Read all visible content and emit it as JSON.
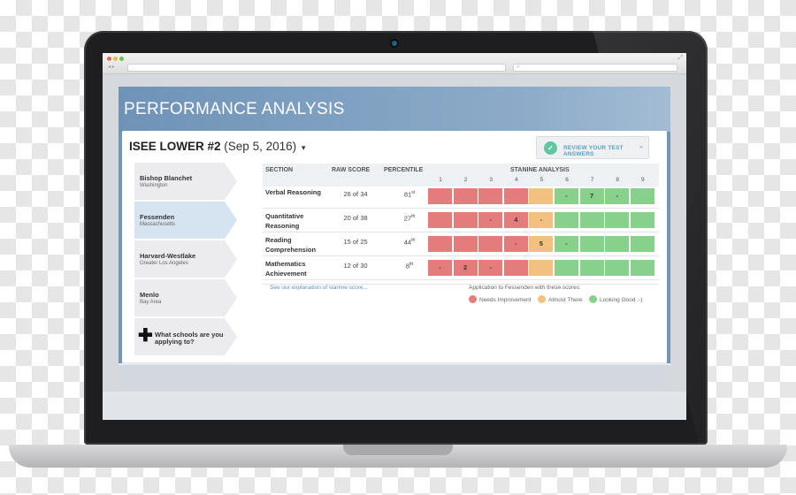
{
  "browser": {
    "url": "",
    "search": "",
    "nav": "◂ ▸"
  },
  "header": {
    "title": "PERFORMANCE ANALYSIS"
  },
  "test": {
    "name": "ISEE LOWER #2",
    "date": "(Sep 5, 2016)",
    "review_button": "REVIEW YOUR TEST ANSWERS"
  },
  "schools": [
    {
      "name": "Bishop Blanchet",
      "location": "Washington"
    },
    {
      "name": "Fessenden",
      "location": "Massachusetts"
    },
    {
      "name": "Harvard-Westlake",
      "location": "Greater Los Angeles"
    },
    {
      "name": "Menlo",
      "location": "Bay Area"
    }
  ],
  "add_school": "What schools are you applying to?",
  "table": {
    "headers": {
      "section": "SECTION",
      "raw": "RAW SCORE",
      "percentile": "PERCENTILE",
      "stanine": "STANINE ANALYSIS"
    },
    "stanine_columns": [
      "1",
      "2",
      "3",
      "4",
      "5",
      "6",
      "7",
      "8",
      "9"
    ],
    "rows": [
      {
        "section": "Verbal Reasoning",
        "raw": "26 of 34",
        "pct": "81",
        "pct_suffix": "st",
        "cells": [
          "red",
          "red",
          "red",
          "red",
          "orange",
          "green",
          "green",
          "green",
          "green"
        ],
        "marks": [
          "",
          "",
          "",
          "",
          "",
          "-",
          "7",
          "-",
          ""
        ]
      },
      {
        "section": "Quantitative Reasoning",
        "raw": "20 of 38",
        "pct": "27",
        "pct_suffix": "th",
        "cells": [
          "red",
          "red",
          "red",
          "red",
          "orange",
          "green",
          "green",
          "green",
          "green"
        ],
        "marks": [
          "",
          "",
          "-",
          "4",
          "-",
          "",
          "",
          "",
          ""
        ]
      },
      {
        "section": "Reading Comprehension",
        "raw": "15 of 25",
        "pct": "44",
        "pct_suffix": "th",
        "cells": [
          "red",
          "red",
          "red",
          "red",
          "orange",
          "green",
          "green",
          "green",
          "green"
        ],
        "marks": [
          "",
          "",
          "",
          "-",
          "5",
          "-",
          "",
          "",
          ""
        ]
      },
      {
        "section": "Mathematics Achievement",
        "raw": "12 of 30",
        "pct": "8",
        "pct_suffix": "th",
        "cells": [
          "red",
          "red",
          "red",
          "red",
          "orange",
          "green",
          "green",
          "green",
          "green"
        ],
        "marks": [
          "-",
          "2",
          "-",
          "",
          "",
          "",
          "",
          "",
          ""
        ]
      }
    ]
  },
  "footer": {
    "stanine_link": "See our explanation of stanine score...",
    "legend_title": "Application to Fessenden with these scores:",
    "legend": [
      {
        "label": "Needs Improvement",
        "color": "#e57c7c"
      },
      {
        "label": "Almost There",
        "color": "#f2c181"
      },
      {
        "label": "Looking Good :-)",
        "color": "#87d28b"
      }
    ]
  }
}
